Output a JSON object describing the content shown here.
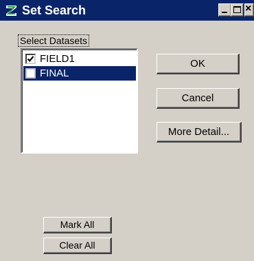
{
  "window": {
    "title": "Set Search",
    "icon": "set-search-app-icon"
  },
  "title_buttons": {
    "minimize": "minimize-icon",
    "maximize": "maximize-icon",
    "close": "close-icon"
  },
  "datasets": {
    "label": "Select Datasets",
    "items": [
      {
        "name": "FIELD1",
        "checked": true,
        "selected": false
      },
      {
        "name": "FINAL",
        "checked": false,
        "selected": true
      }
    ]
  },
  "buttons": {
    "ok": "OK",
    "cancel": "Cancel",
    "more_detail": "More Detail...",
    "mark_all": "Mark All",
    "clear_all": "Clear All"
  },
  "colors": {
    "title_bar": "#0a246a",
    "dialog_face": "#d4d0c8",
    "selection": "#0a246a"
  }
}
